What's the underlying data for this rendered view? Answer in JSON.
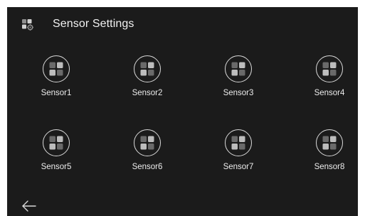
{
  "header": {
    "title": "Sensor Settings",
    "icon": "sensor-settings-icon"
  },
  "sensors": [
    {
      "label": "Sensor1",
      "icon": "sensor-grid-icon"
    },
    {
      "label": "Sensor2",
      "icon": "sensor-grid-icon"
    },
    {
      "label": "Sensor3",
      "icon": "sensor-grid-icon"
    },
    {
      "label": "Sensor4",
      "icon": "sensor-grid-icon"
    },
    {
      "label": "Sensor5",
      "icon": "sensor-grid-icon"
    },
    {
      "label": "Sensor6",
      "icon": "sensor-grid-icon"
    },
    {
      "label": "Sensor7",
      "icon": "sensor-grid-icon"
    },
    {
      "label": "Sensor8",
      "icon": "sensor-grid-icon"
    }
  ],
  "footer": {
    "back_icon": "back-arrow-icon"
  },
  "colors": {
    "background": "#1b1b1b",
    "text": "#ececec",
    "ring": "#d9d9d9",
    "tile_light": "#bdbdbd",
    "tile_dark": "#6a6a6a"
  }
}
